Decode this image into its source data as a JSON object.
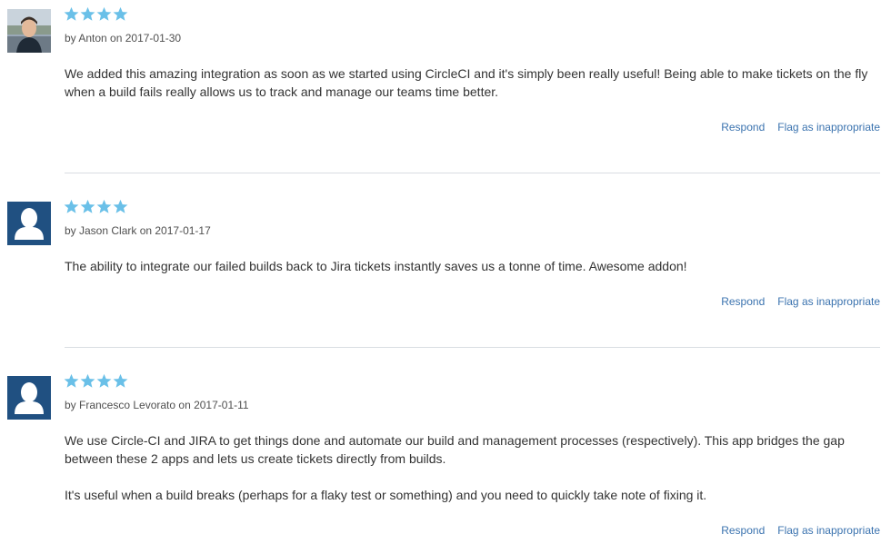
{
  "theme": {
    "star_color": "#6ac0e8",
    "link_color": "#3b73af",
    "avatar_default_bg": "#205081"
  },
  "reviews": [
    {
      "stars": 4,
      "author": "Anton",
      "date": "2017-01-30",
      "byline": "by Anton on 2017-01-30",
      "avatar_icon": "user-photo",
      "paragraphs": [
        "We added this amazing integration as soon as we started using CircleCI and it's simply been really useful! Being able to make tickets on the fly when a build fails really allows us to track and manage our teams time better."
      ],
      "respond_label": "Respond",
      "flag_label": "Flag as inappropriate"
    },
    {
      "stars": 4,
      "author": "Jason Clark",
      "date": "2017-01-17",
      "byline": "by Jason Clark on 2017-01-17",
      "avatar_icon": "default-user-icon",
      "paragraphs": [
        "The ability to integrate our failed builds back to Jira tickets instantly saves us a tonne of time. Awesome addon!"
      ],
      "respond_label": "Respond",
      "flag_label": "Flag as inappropriate"
    },
    {
      "stars": 4,
      "author": "Francesco Levorato",
      "date": "2017-01-11",
      "byline": "by Francesco Levorato on 2017-01-11",
      "avatar_icon": "default-user-icon",
      "paragraphs": [
        "We use Circle-CI and JIRA to get things done and automate our build and management processes (respectively). This app bridges the gap between these 2 apps and lets us create tickets directly from builds.",
        "It's useful when a build breaks (perhaps for a flaky test or something) and you need to quickly take note of fixing it."
      ],
      "respond_label": "Respond",
      "flag_label": "Flag as inappropriate"
    }
  ]
}
